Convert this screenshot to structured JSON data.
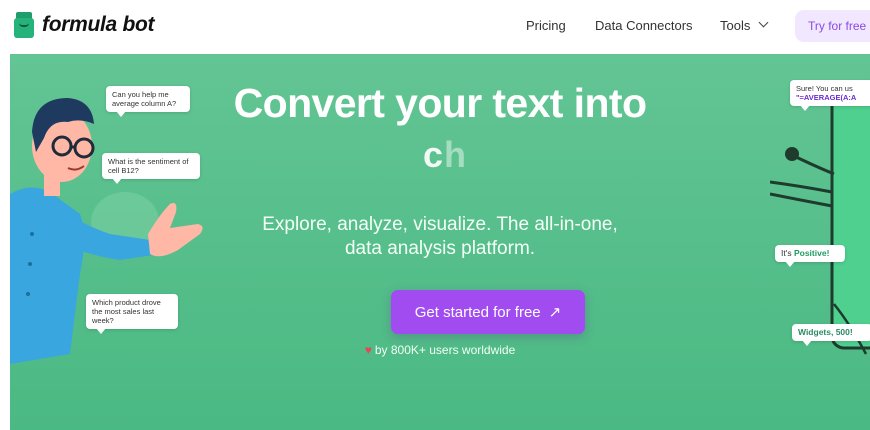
{
  "nav": {
    "logo_text": "formula bot",
    "links": [
      "Pricing",
      "Data Connectors",
      "Tools"
    ],
    "cta_label": "Try for free"
  },
  "hero": {
    "title": "Convert your text into",
    "typed_visible": "c",
    "typed_ghost": "h",
    "subtitle_line1": "Explore, analyze, visualize. The all-in-one,",
    "subtitle_line2": "data analysis platform.",
    "cta_label": "Get started for free",
    "cta_arrow": "↗",
    "social_proof": "by 800K+ users worldwide",
    "heart_glyph": "♥"
  },
  "bubbles": {
    "b1": "Can you help me average column A?",
    "b2": "What is the sentiment of cell B12?",
    "b3": "Which product drove the most sales last week?",
    "b4_text": "Sure! You can us",
    "b4_formula": "\"=AVERAGE(A:A",
    "b5_prefix": "It's ",
    "b5_value": "Positive!",
    "b6": "Widgets, 500!"
  },
  "colors": {
    "hero_green": "#5bc190",
    "cta_purple": "#a14cf0",
    "nav_cta_bg": "#f1e7ff",
    "nav_cta_text": "#8a4be6",
    "brand_green": "#26b37b"
  }
}
